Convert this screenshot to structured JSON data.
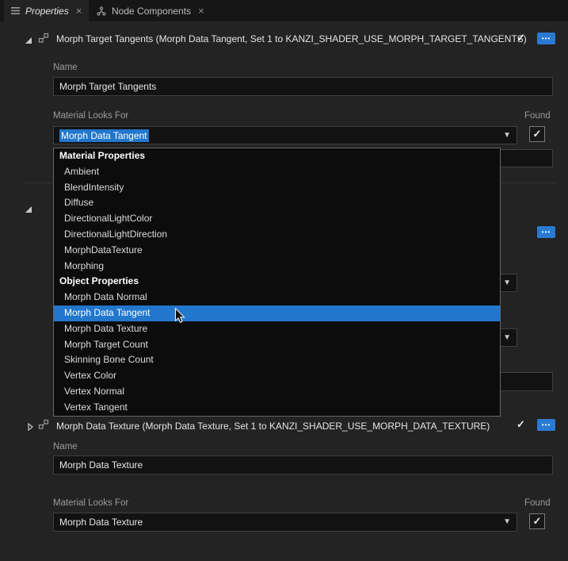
{
  "colors": {
    "accent_blue": "#2a7ad2",
    "selection_blue": "#2277cc"
  },
  "tabs": [
    {
      "label": "Properties",
      "close": "×"
    },
    {
      "label": "Node Components",
      "close": "×"
    }
  ],
  "section_morph_target_tangents": {
    "title": "Morph Target Tangents (Morph Data Tangent, Set 1 to KANZI_SHADER_USE_MORPH_TARGET_TANGENTS)",
    "enabled_checkmark": "✓",
    "menu_dots": "•••",
    "name_label": "Name",
    "name_value": "Morph Target Tangents",
    "material_label": "Material Looks For",
    "material_value": "Morph Data Tangent",
    "found_label": "Found",
    "found_checkmark": "✓"
  },
  "dropdown": {
    "items": [
      {
        "label": "Material Properties",
        "type": "header"
      },
      {
        "label": "Ambient",
        "type": "item"
      },
      {
        "label": "BlendIntensity",
        "type": "item"
      },
      {
        "label": "Diffuse",
        "type": "item"
      },
      {
        "label": "DirectionalLightColor",
        "type": "item"
      },
      {
        "label": "DirectionalLightDirection",
        "type": "item"
      },
      {
        "label": "MorphDataTexture",
        "type": "item"
      },
      {
        "label": "Morphing",
        "type": "item"
      },
      {
        "label": "Object Properties",
        "type": "header"
      },
      {
        "label": "Morph Data Normal",
        "type": "item"
      },
      {
        "label": "Morph Data Tangent",
        "type": "item",
        "selected": true
      },
      {
        "label": "Morph Data Texture",
        "type": "item"
      },
      {
        "label": "Morph Target Count",
        "type": "item"
      },
      {
        "label": "Skinning Bone Count",
        "type": "item"
      },
      {
        "label": "Vertex Color",
        "type": "item"
      },
      {
        "label": "Vertex Normal",
        "type": "item"
      },
      {
        "label": "Vertex Tangent",
        "type": "item"
      }
    ]
  },
  "hidden_section": {
    "menu_dots": "•••"
  },
  "section_morph_data_texture": {
    "title": "Morph Data Texture (Morph Data Texture, Set 1 to KANZI_SHADER_USE_MORPH_DATA_TEXTURE)",
    "enabled_checkmark": "✓",
    "menu_dots": "•••",
    "name_label": "Name",
    "name_value": "Morph Data Texture",
    "material_label": "Material Looks For",
    "material_value": "Morph Data Texture",
    "found_label": "Found",
    "found_checkmark": "✓"
  }
}
